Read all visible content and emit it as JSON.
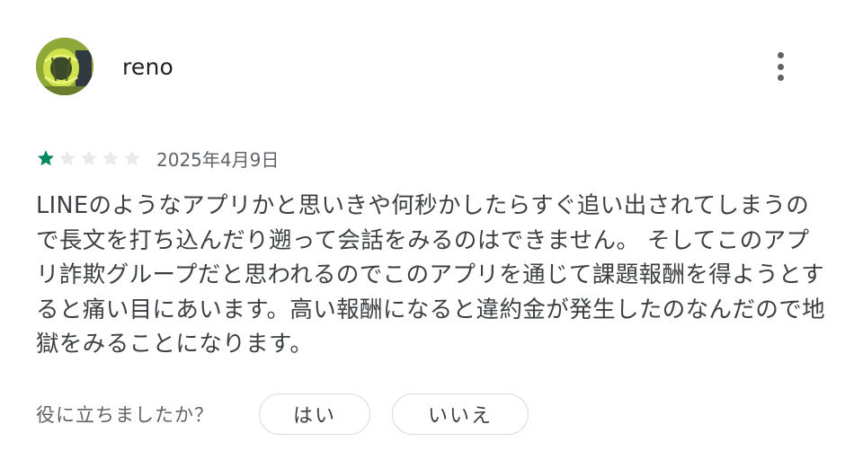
{
  "review": {
    "author": {
      "name": "reno",
      "avatar_icon": "user-avatar-photo"
    },
    "menu_icon": "more-vert-icon",
    "rating": {
      "stars": 1,
      "max_stars": 5,
      "filled_color": "#01875f",
      "empty_color": "#e8eaed"
    },
    "date": "2025年4月9日",
    "text": "LINEのようなアプリかと思いきや何秒かしたらすぐ追い出されてしまうので長文を打ち込んだり遡って会話をみるのはできません。 そしてこのアプリ詐欺グループだと思われるのでこのアプリを通じて課題報酬を得ようとすると痛い目にあいます。高い報酬になると違約金が発生したのなんだので地獄をみることになります。",
    "helpful": {
      "question": "役に立ちましたか？",
      "yes_label": "はい",
      "no_label": "いいえ"
    }
  }
}
